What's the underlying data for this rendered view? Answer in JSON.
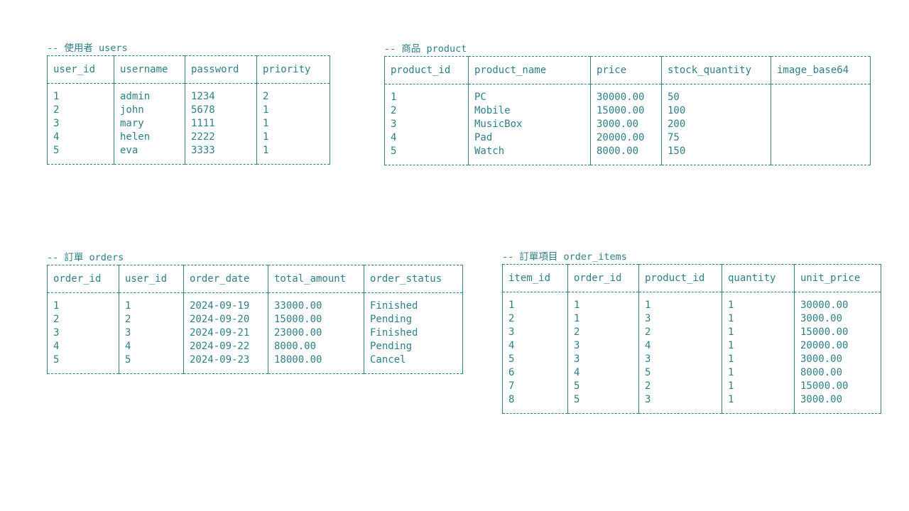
{
  "tables": {
    "users": {
      "title": "-- 使用者 users",
      "columns": [
        "user_id",
        "username",
        "password",
        "priority"
      ],
      "rows": [
        [
          "1",
          "admin",
          "1234",
          "2"
        ],
        [
          "2",
          "john",
          "5678",
          "1"
        ],
        [
          "3",
          "mary",
          "1111",
          "1"
        ],
        [
          "4",
          "helen",
          "2222",
          "1"
        ],
        [
          "5",
          "eva",
          "3333",
          "1"
        ]
      ]
    },
    "product": {
      "title": "-- 商品 product",
      "columns": [
        "product_id",
        "product_name",
        "price",
        "stock_quantity",
        "image_base64"
      ],
      "rows": [
        [
          "1",
          "PC",
          "30000.00",
          "50",
          ""
        ],
        [
          "2",
          "Mobile",
          "15000.00",
          "100",
          ""
        ],
        [
          "3",
          "MusicBox",
          "3000.00",
          "200",
          ""
        ],
        [
          "4",
          "Pad",
          "20000.00",
          "75",
          ""
        ],
        [
          "5",
          "Watch",
          "8000.00",
          "150",
          ""
        ]
      ]
    },
    "orders": {
      "title": "-- 訂單 orders",
      "columns": [
        "order_id",
        "user_id",
        "order_date",
        "total_amount",
        "order_status"
      ],
      "rows": [
        [
          "1",
          "1",
          "2024-09-19",
          "33000.00",
          "Finished"
        ],
        [
          "2",
          "2",
          "2024-09-20",
          "15000.00",
          "Pending"
        ],
        [
          "3",
          "3",
          "2024-09-21",
          "23000.00",
          "Finished"
        ],
        [
          "4",
          "4",
          "2024-09-22",
          "8000.00",
          "Pending"
        ],
        [
          "5",
          "5",
          "2024-09-23",
          "18000.00",
          "Cancel"
        ]
      ]
    },
    "order_items": {
      "title": "-- 訂單項目 order_items",
      "columns": [
        "item_id",
        "order_id",
        "product_id",
        "quantity",
        "unit_price"
      ],
      "rows": [
        [
          "1",
          "1",
          "1",
          "1",
          "30000.00"
        ],
        [
          "2",
          "1",
          "3",
          "1",
          "3000.00"
        ],
        [
          "3",
          "2",
          "2",
          "1",
          "15000.00"
        ],
        [
          "4",
          "3",
          "4",
          "1",
          "20000.00"
        ],
        [
          "5",
          "3",
          "3",
          "1",
          "3000.00"
        ],
        [
          "6",
          "4",
          "5",
          "1",
          "8000.00"
        ],
        [
          "7",
          "5",
          "2",
          "1",
          "15000.00"
        ],
        [
          "8",
          "5",
          "3",
          "1",
          "3000.00"
        ]
      ]
    }
  }
}
